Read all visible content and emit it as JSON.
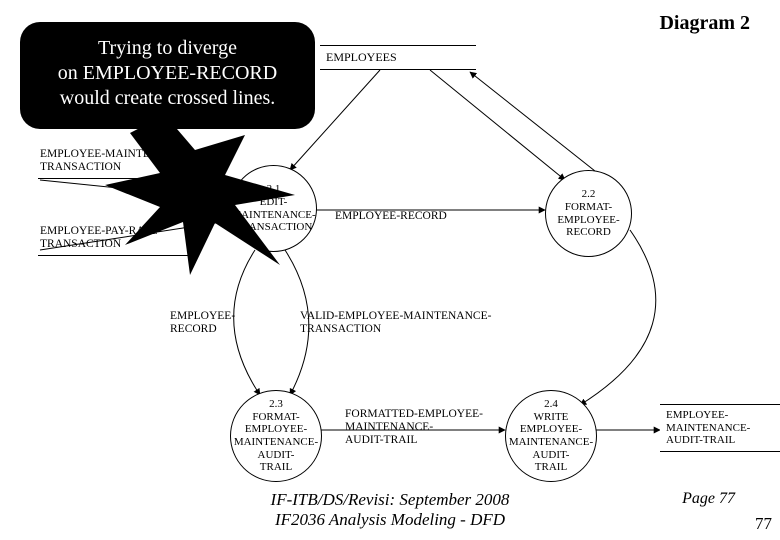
{
  "title": "Diagram 2",
  "callout": {
    "line1": "Trying to diverge",
    "line2": "on EMPLOYEE-RECORD",
    "line3": "would create crossed lines."
  },
  "stores": {
    "employees": "EMPLOYEES",
    "emp_audit_trail": "EMPLOYEE-\nMAINTENANCE-\nAUDIT-TRAIL"
  },
  "processes": {
    "p21": "2.1\nEDIT-\nMAINTENANCE-\nTRANSACTION",
    "p22": "2.2\nFORMAT-\nEMPLOYEE-\nRECORD",
    "p23": "2.3\nFORMAT-\nEMPLOYEE-\nMAINTENANCE-\nAUDIT-\nTRAIL",
    "p24": "2.4\nWRITE\nEMPLOYEE-\nMAINTENANCE-\nAUDIT-\nTRAIL"
  },
  "flows": {
    "emp_maint_trans": "EMPLOYEE-MAINTENANCE-\nTRANSACTION",
    "emp_pay_rate_trans": "EMPLOYEE-PAY-RATE-\nTRANSACTION",
    "employee_record_top": "EMPLOYEE-RECORD",
    "employee_record_left": "EMPLOYEE-\nRECORD",
    "valid_trans": "VALID-EMPLOYEE-MAINTENANCE-\nTRANSACTION",
    "formatted_audit": "FORMATTED-EMPLOYEE-\nMAINTENANCE-\nAUDIT-TRAIL"
  },
  "footer": {
    "line1": "IF-ITB/DS/Revisi: September 2008",
    "line2": "IF2036 Analysis Modeling - DFD",
    "page": "Page 77",
    "slide": "77"
  }
}
